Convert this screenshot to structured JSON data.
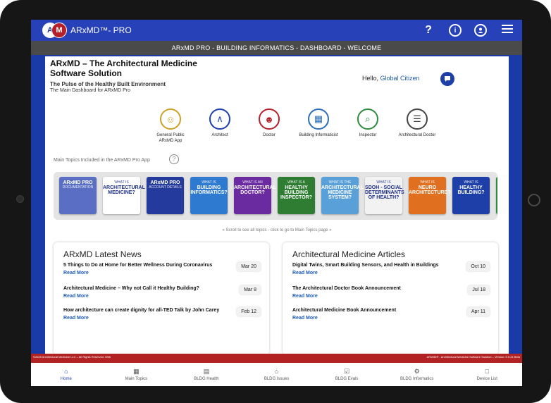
{
  "app": {
    "logo_letter_a": "A",
    "logo_letter_m": "M",
    "logo_text": "ARxMD™- PRO",
    "icons": [
      "help-icon",
      "info-icon",
      "account-icon",
      "menu-icon"
    ],
    "help_glyph": "?",
    "info_glyph": "i"
  },
  "titlebar": "ARxMD PRO - BUILDING INFORMATICS - DASHBOARD - WELCOME",
  "header": {
    "title": "ARxMD – The Architectural Medicine Software Solution",
    "subtitle": "The Pulse of the Healthy Built Environment",
    "subtitle2": "The Main Dashboard for ARxMD Pro",
    "hello_prefix": "Hello, ",
    "hello_name": "Global Citizen"
  },
  "roles": [
    {
      "label": "General Public ARxMD App",
      "color": "#c9a227",
      "icon": "person-icon",
      "glyph": "☺"
    },
    {
      "label": "Architect",
      "color": "#1e3fa8",
      "icon": "compass-icon",
      "glyph": "∧"
    },
    {
      "label": "Doctor",
      "color": "#b3202a",
      "icon": "doctor-icon",
      "glyph": "☻"
    },
    {
      "label": "Building Informaticist",
      "color": "#2c6fb8",
      "icon": "building-icon",
      "glyph": "▦"
    },
    {
      "label": "Inspector",
      "color": "#2e8b3e",
      "icon": "inspect-icon",
      "glyph": "⌕"
    },
    {
      "label": "Architectural Doctor",
      "color": "#444444",
      "icon": "clipboard-icon",
      "glyph": "☰"
    }
  ],
  "topics": {
    "header": "Main Topics Included in the ARxMD Pro App",
    "help": "?",
    "scroll_hint": "« Scroll to see all topics - click to go to Main Topics page »",
    "tiles": [
      {
        "small": "",
        "big": "ARxMD PRO",
        "sub": "DOCUMENTATION",
        "color": "#5a6fc4"
      },
      {
        "small": "WHAT IS",
        "big": "ARCHITECTURAL MEDICINE?",
        "sub": "",
        "color": "#ffffff"
      },
      {
        "small": "",
        "big": "ARxMD PRO",
        "sub": "ACCOUNT DETAILS",
        "color": "#243a9c"
      },
      {
        "small": "WHAT IS",
        "big": "BUILDING INFORMATICS?",
        "sub": "",
        "color": "#2f7ad1"
      },
      {
        "small": "WHAT IS AN",
        "big": "ARCHITECTURAL DOCTOR?",
        "sub": "",
        "color": "#6a2aa0"
      },
      {
        "small": "WHAT IS A",
        "big": "HEALTHY BUILDING INSPECTOR?",
        "sub": "",
        "color": "#2e7d32"
      },
      {
        "small": "WHAT IS THE",
        "big": "ARCHITECTURAL MEDICINE SYSTEM?",
        "sub": "",
        "color": "#5aa0d8"
      },
      {
        "small": "WHAT IS",
        "big": "SDOH - SOCIAL DETERMINANTS OF HEALTH?",
        "sub": "",
        "color": "#f2f2f2"
      },
      {
        "small": "WHAT IS",
        "big": "NEURO ARCHITECTURE?",
        "sub": "",
        "color": "#e07020"
      },
      {
        "small": "WHAT IS",
        "big": "HEALTHY BUILDING?",
        "sub": "",
        "color": "#1e3fa8"
      },
      {
        "small": "",
        "big": "",
        "sub": "",
        "color": "#2e8b3e"
      }
    ]
  },
  "news": {
    "title": "ARxMD Latest News",
    "items": [
      {
        "title": "5 Things to Do at Home for Better Wellness During Coronavirus",
        "read_more": "Read More",
        "date": "Mar 20"
      },
      {
        "title": "Architectural Medicine – Why not Call it Healthy Building?",
        "read_more": "Read More",
        "date": "Mar 8"
      },
      {
        "title": "How architecture can create dignity for all-TED Talk by John Carey",
        "read_more": "Read More",
        "date": "Feb 12"
      }
    ]
  },
  "articles": {
    "title": "Architectural Medicine Articles",
    "items": [
      {
        "title": "Digital Twins, Smart Building Sensors, and Health in Buildings",
        "read_more": "Read More",
        "date": "Oct 10"
      },
      {
        "title": "The Architectural Doctor Book Announcement",
        "read_more": "Read More",
        "date": "Jul 18"
      },
      {
        "title": "Architectural Medicine Book Announcement",
        "read_more": "Read More",
        "date": "Apr 11"
      }
    ]
  },
  "footer": {
    "left": "©2025 Architectural Medicine LLC – All Rights Reserved. Web",
    "right": "ARxMD® - Architectural Medicine Software Solution – Version: 5.9.24 Beta"
  },
  "nav": [
    {
      "label": "Home",
      "icon": "home-icon",
      "glyph": "⌂"
    },
    {
      "label": "Main Topics",
      "icon": "grid-icon",
      "glyph": "▦"
    },
    {
      "label": "BLDG Health",
      "icon": "building-health-icon",
      "glyph": "▤"
    },
    {
      "label": "BLDG Issues",
      "icon": "building-issues-icon",
      "glyph": "⌂"
    },
    {
      "label": "BLDG Evals",
      "icon": "clipboard-icon",
      "glyph": "☑"
    },
    {
      "label": "BLDG Informatics",
      "icon": "network-icon",
      "glyph": "⚙"
    },
    {
      "label": "Device List",
      "icon": "device-icon",
      "glyph": "□"
    }
  ]
}
